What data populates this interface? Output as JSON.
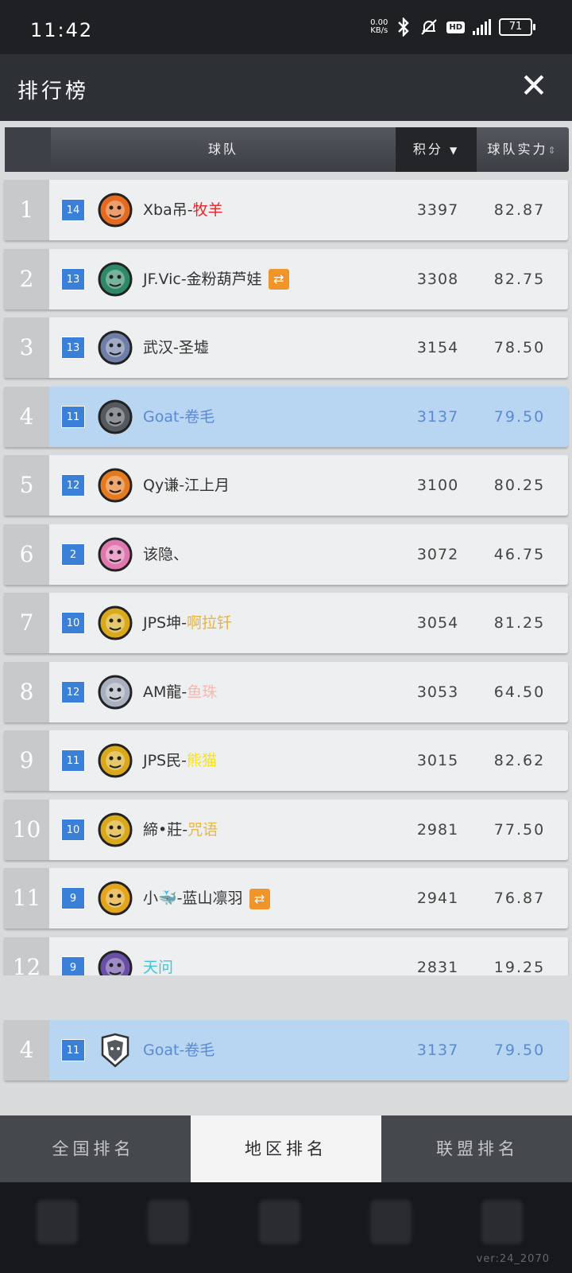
{
  "status": {
    "time": "11:42",
    "net_top": "0.00",
    "net_bottom": "KB/s",
    "hd": "HD",
    "battery": "71"
  },
  "header": {
    "title": "排行榜"
  },
  "table": {
    "col_team": "球队",
    "col_score": "积分",
    "col_power": "球队实力",
    "rows": [
      {
        "rank": "1",
        "level": "14",
        "name_a": "Xba吊-",
        "name_b": "牧羊",
        "name_b_color": "#e8252a",
        "score": "3397",
        "power": "82.87",
        "logo_color": "#e36a1e",
        "swap": false
      },
      {
        "rank": "2",
        "level": "13",
        "name_a": "JF.Vic-金粉葫芦娃",
        "name_b": "",
        "name_b_color": "#333333",
        "score": "3308",
        "power": "82.75",
        "logo_color": "#2e8a66",
        "swap": true
      },
      {
        "rank": "3",
        "level": "13",
        "name_a": "武汉-圣墟",
        "name_b": "",
        "name_b_color": "#333333",
        "score": "3154",
        "power": "78.50",
        "logo_color": "#6f7ea6",
        "swap": false
      },
      {
        "rank": "4",
        "level": "11",
        "name_a": "Goat-卷毛",
        "name_b": "",
        "name_b_color": "#5a8ad6",
        "score": "3137",
        "power": "79.50",
        "logo_color": "#555a60",
        "swap": false
      },
      {
        "rank": "5",
        "level": "12",
        "name_a": "Qy谦-江上月",
        "name_b": "",
        "name_b_color": "#333333",
        "score": "3100",
        "power": "80.25",
        "logo_color": "#e57a1f",
        "swap": false
      },
      {
        "rank": "6",
        "level": "2",
        "name_a": "该隐、",
        "name_b": "",
        "name_b_color": "#333333",
        "score": "3072",
        "power": "46.75",
        "logo_color": "#e078b0",
        "swap": false
      },
      {
        "rank": "7",
        "level": "10",
        "name_a": "JPS坤-",
        "name_b": "啊拉钎",
        "name_b_color": "#e6b33c",
        "score": "3054",
        "power": "81.25",
        "logo_color": "#d9a91b",
        "swap": false
      },
      {
        "rank": "8",
        "level": "12",
        "name_a": "AM龍-",
        "name_b": "鱼珠",
        "name_b_color": "#f5b9b0",
        "score": "3053",
        "power": "64.50",
        "logo_color": "#a9b0c0",
        "swap": false
      },
      {
        "rank": "9",
        "level": "11",
        "name_a": "JPS民-",
        "name_b": "熊猫",
        "name_b_color": "#f5e21a",
        "score": "3015",
        "power": "82.62",
        "logo_color": "#d9a91b",
        "swap": false
      },
      {
        "rank": "10",
        "level": "10",
        "name_a": "締•莊-",
        "name_b": "咒语",
        "name_b_color": "#efb53a",
        "score": "2981",
        "power": "77.50",
        "logo_color": "#d9a91b",
        "swap": false
      },
      {
        "rank": "11",
        "level": "9",
        "name_a": "小🐳-蓝山凛羽",
        "name_b": "",
        "name_b_color": "#333333",
        "score": "2941",
        "power": "76.87",
        "logo_color": "#e2a51c",
        "swap": true
      },
      {
        "rank": "12",
        "level": "9",
        "name_a": "",
        "name_b": "天问",
        "name_b_color": "#3ec7d6",
        "score": "2831",
        "power": "19.25",
        "logo_color": "#6a4fa8",
        "swap": false
      }
    ],
    "me": {
      "rank": "4",
      "level": "11",
      "name": "Goat-卷毛",
      "score": "3137",
      "power": "79.50"
    }
  },
  "tabs": [
    "全国排名",
    "地区排名",
    "联盟排名"
  ],
  "active_tab": 1,
  "version": "ver:24_2070",
  "colors": {
    "header_bg": "#2d3035",
    "highlight_row": "#b8d6f1",
    "level_badge": "#3a7fd8",
    "swap_badge": "#f0952a"
  },
  "icons": {
    "close": "close-icon",
    "swap": "swap-icon",
    "sort_desc": "triangle-down-icon",
    "sort_both": "sort-icon"
  }
}
